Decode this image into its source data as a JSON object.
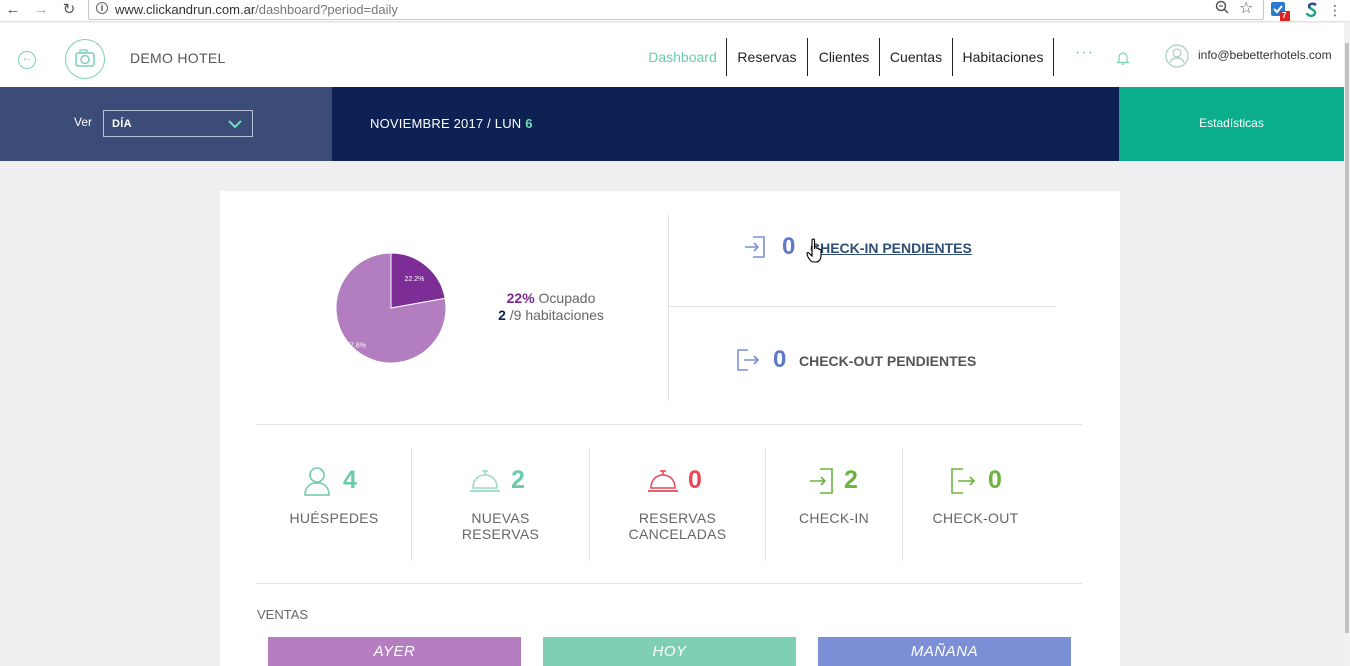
{
  "browser": {
    "url_host": "www.clickandrun.com.ar",
    "url_path": "/dashboard?period=daily",
    "extension_badge": "7"
  },
  "header": {
    "hotel_name": "DEMO HOTEL",
    "nav": [
      {
        "label": "Dashboard",
        "active": true
      },
      {
        "label": "Reservas",
        "active": false
      },
      {
        "label": "Clientes",
        "active": false
      },
      {
        "label": "Cuentas",
        "active": false
      },
      {
        "label": "Habitaciones",
        "active": false
      }
    ],
    "more": "···",
    "user_email": "info@bebetterhotels.com"
  },
  "toolbar": {
    "ver_label": "Ver",
    "period_value": "DÍA",
    "date_prefix": "NOVIEMBRE 2017 / LUN ",
    "date_day": "6",
    "stats_label": "Estadísticas"
  },
  "occupancy": {
    "pct_text": "22%",
    "pct_label": "Ocupado",
    "rooms_occupied": "2",
    "rooms_rest": "/9 habitaciones"
  },
  "chart_data": {
    "type": "pie",
    "slices": [
      {
        "label": "22.2%",
        "value": 22.2,
        "color": "#7d2d96"
      },
      {
        "label": "77.8%",
        "value": 77.8,
        "color": "#b27ec0"
      }
    ]
  },
  "pending": {
    "checkin_count": "0",
    "checkin_label": "CHECK-IN PENDIENTES",
    "checkout_count": "0",
    "checkout_label": "CHECK-OUT PENDIENTES"
  },
  "metrics": [
    {
      "value": "4",
      "name": "HUÉSPEDES",
      "color": "#6ccaae",
      "icon": "guest-icon"
    },
    {
      "value": "2",
      "name": "NUEVAS RESERVAS",
      "color": "#6ccaae",
      "icon": "bell-service-icon"
    },
    {
      "value": "0",
      "name": "RESERVAS CANCELADAS",
      "color": "#e8485a",
      "icon": "bell-service-icon"
    },
    {
      "value": "2",
      "name": "CHECK-IN",
      "color": "#6db33f",
      "icon": "checkin-icon"
    },
    {
      "value": "0",
      "name": "CHECK-OUT",
      "color": "#6db33f",
      "icon": "checkout-icon"
    }
  ],
  "ventas": {
    "label": "VENTAS",
    "buttons": [
      {
        "label": "AYER",
        "color": "#b57ec0"
      },
      {
        "label": "HOY",
        "color": "#7fcfb5"
      },
      {
        "label": "MAÑANA",
        "color": "#7b8fd6"
      }
    ]
  }
}
